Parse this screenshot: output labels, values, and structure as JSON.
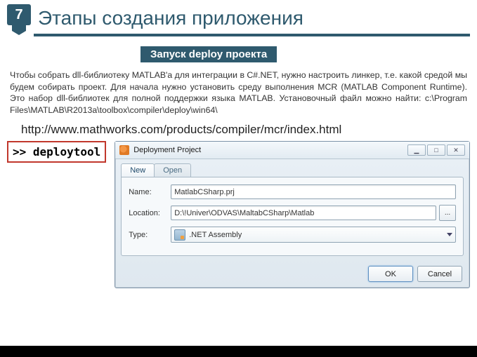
{
  "header": {
    "slide_number": "7",
    "title": "Этапы создания приложения"
  },
  "subheader": "Запуск deploy проекта",
  "paragraph": "Чтобы собрать dll-библиотеку MATLAB'а для интеграции в C#.NET, нужно настроить линкер, т.е. какой средой мы будем собирать проект. Для начала нужно установить среду выполнения MCR (MATLAB Component Runtime). Это набор dll-библиотек для полной поддержки языка MATLAB. Установочный файл можно найти: c:\\Program Files\\MATLAB\\R2013a\\toolbox\\compiler\\deploy\\win64\\",
  "url": "http://www.mathworks.com/products/compiler/mcr/index.html",
  "command": {
    "prompt": ">> ",
    "text": "deploytool"
  },
  "window": {
    "title": "Deployment Project",
    "controls": {
      "min": "▁",
      "max": "□",
      "close": "✕"
    },
    "tabs": {
      "new": "New",
      "open": "Open"
    },
    "form": {
      "name_label": "Name:",
      "name_value": "MatlabCSharp.prj",
      "location_label": "Location:",
      "location_value": "D:\\!Univer\\ODVAS\\MaltabCSharp\\Matlab",
      "browse": "...",
      "type_label": "Type:",
      "type_value": ".NET Assembly"
    },
    "buttons": {
      "ok": "OK",
      "cancel": "Cancel"
    }
  }
}
